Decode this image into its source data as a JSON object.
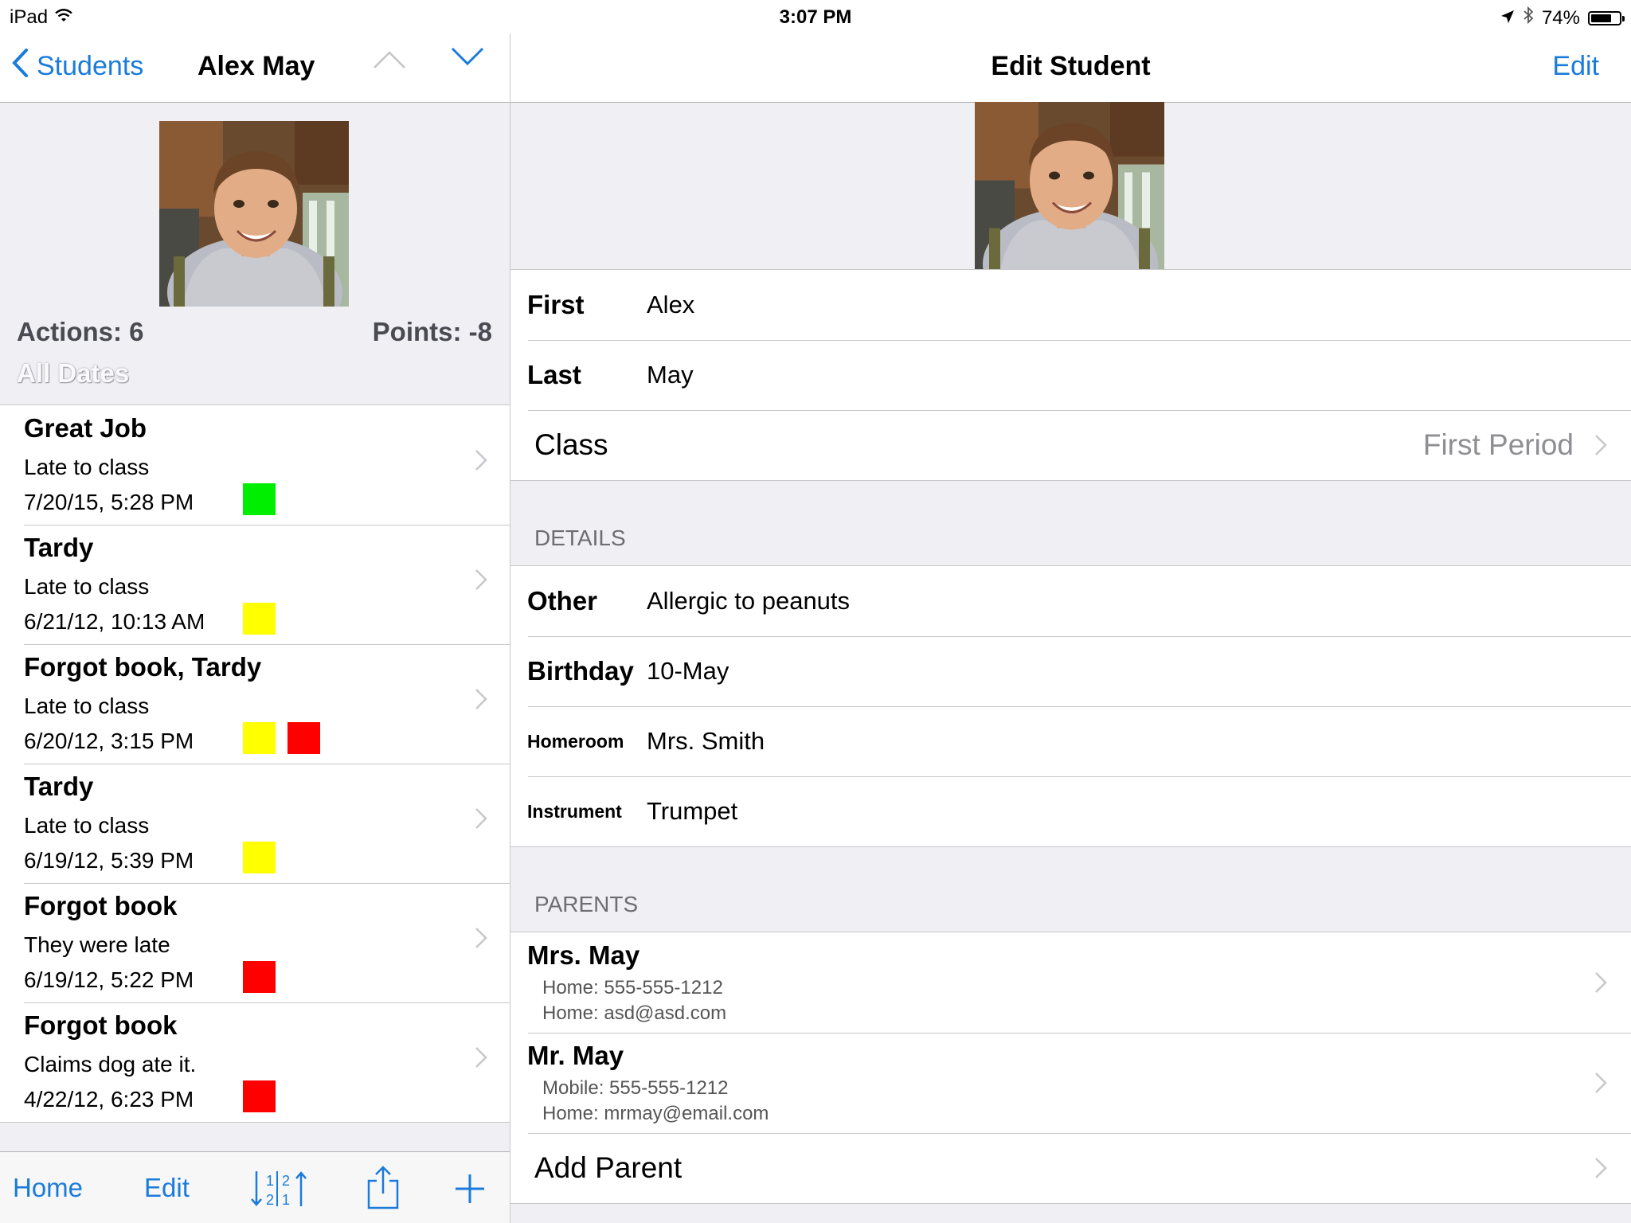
{
  "status_bar": {
    "device": "iPad",
    "time": "3:07 PM",
    "battery": "74%",
    "battery_level": 0.74,
    "icons": [
      "wifi-icon",
      "location-arrow-icon",
      "bluetooth-icon",
      "battery-icon"
    ]
  },
  "colors": {
    "accent": "#1a7bdb",
    "green": "#00ee00",
    "yellow": "#ffff00",
    "red": "#ff0000"
  },
  "left": {
    "nav": {
      "back_label": "Students",
      "title": "Alex May"
    },
    "summary": {
      "actions": "Actions: 6",
      "points": "Points: -8",
      "date_filter": "All Dates"
    },
    "actions": [
      {
        "title": "Great Job",
        "note": "Late to class",
        "date": "7/20/15, 5:28 PM",
        "swatches": [
          "green"
        ]
      },
      {
        "title": "Tardy",
        "note": "Late to class",
        "date": "6/21/12, 10:13 AM",
        "swatches": [
          "yellow"
        ]
      },
      {
        "title": "Forgot book, Tardy",
        "note": "Late to class",
        "date": "6/20/12, 3:15 PM",
        "swatches": [
          "yellow",
          "red"
        ]
      },
      {
        "title": "Tardy",
        "note": "Late to class",
        "date": "6/19/12, 5:39 PM",
        "swatches": [
          "yellow"
        ]
      },
      {
        "title": "Forgot book",
        "note": "They were late",
        "date": "6/19/12, 5:22 PM",
        "swatches": [
          "red"
        ]
      },
      {
        "title": "Forgot book",
        "note": "Claims dog ate it.",
        "date": "4/22/12, 6:23 PM",
        "swatches": [
          "red"
        ]
      }
    ],
    "toolbar": {
      "home": "Home",
      "edit": "Edit"
    }
  },
  "right": {
    "nav": {
      "title": "Edit Student",
      "edit": "Edit"
    },
    "name_fields": [
      {
        "label": "First",
        "value": "Alex"
      },
      {
        "label": "Last",
        "value": "May"
      }
    ],
    "class_row": {
      "label": "Class",
      "value": "First Period"
    },
    "details_header": "DETAILS",
    "details": [
      {
        "label": "Other",
        "value": "Allergic to peanuts",
        "small": false
      },
      {
        "label": "Birthday",
        "value": "10-May",
        "small": false
      },
      {
        "label": "Homeroom",
        "value": "Mrs. Smith",
        "small": true
      },
      {
        "label": "Instrument",
        "value": "Trumpet",
        "small": true
      }
    ],
    "parents_header": "PARENTS",
    "parents": [
      {
        "name": "Mrs. May",
        "line1": "Home: 555-555-1212",
        "line2": "Home: asd@asd.com"
      },
      {
        "name": "Mr. May",
        "line1": "Mobile: 555-555-1212",
        "line2": "Home: mrmay@email.com"
      }
    ],
    "add_parent": "Add Parent"
  }
}
